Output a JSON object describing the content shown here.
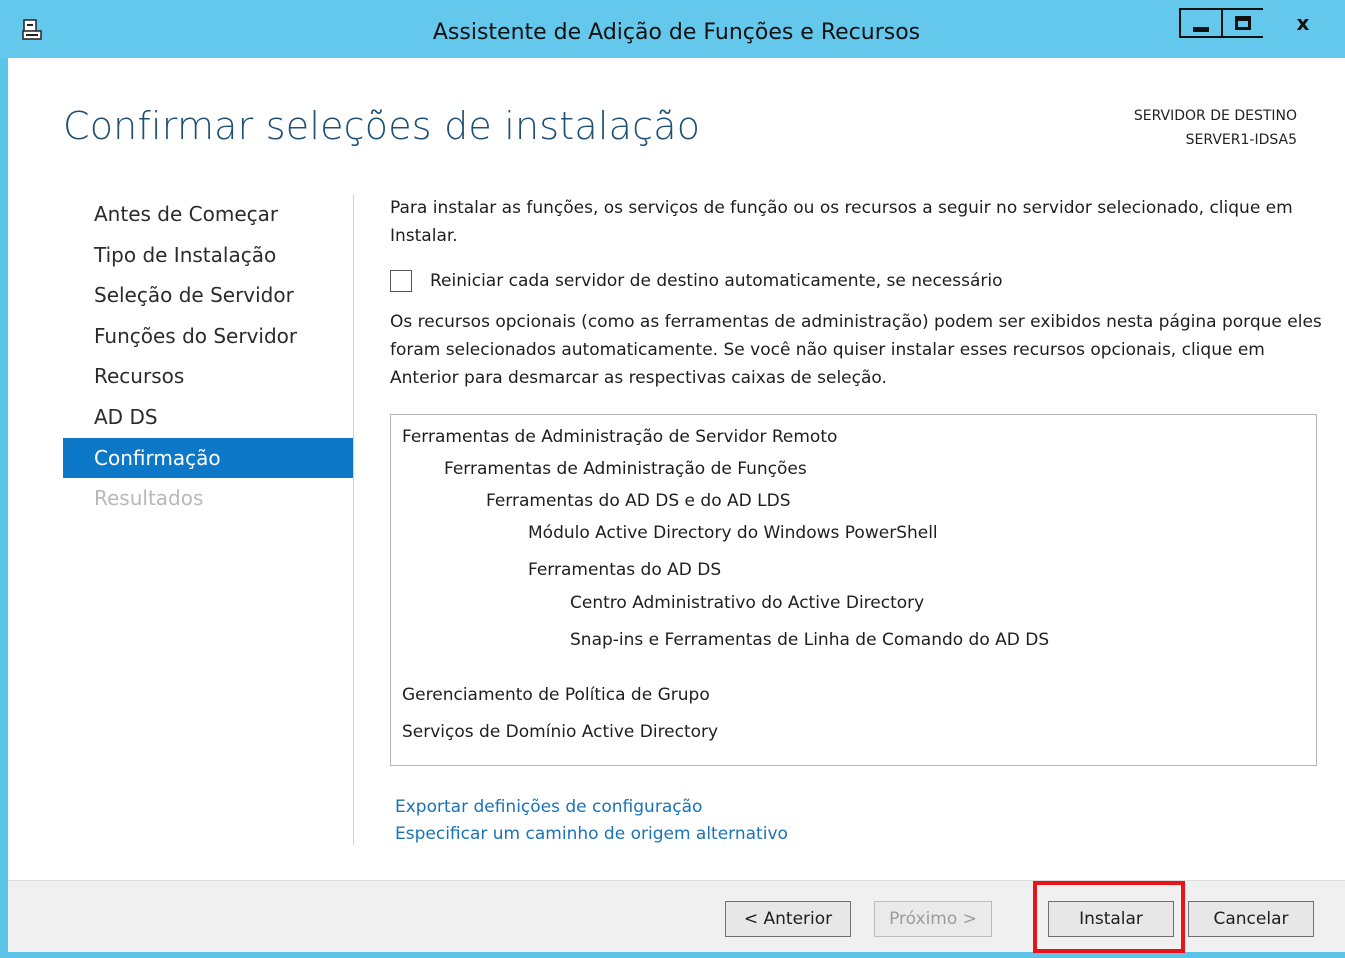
{
  "window": {
    "title": "Assistente de Adição de Funções e Recursos",
    "close_label": "x"
  },
  "header": {
    "page_title": "Confirmar seleções de instalação",
    "dest_label": "SERVIDOR DE DESTINO",
    "dest_server": "SERVER1-IDSA5"
  },
  "nav": {
    "items": [
      {
        "label": "Antes de Começar",
        "state": "normal"
      },
      {
        "label": "Tipo de Instalação",
        "state": "normal"
      },
      {
        "label": "Seleção de Servidor",
        "state": "normal"
      },
      {
        "label": "Funções do Servidor",
        "state": "normal"
      },
      {
        "label": "Recursos",
        "state": "normal"
      },
      {
        "label": "AD DS",
        "state": "normal"
      },
      {
        "label": "Confirmação",
        "state": "active"
      },
      {
        "label": "Resultados",
        "state": "disabled"
      }
    ]
  },
  "main": {
    "intro": "Para instalar as funções, os serviços de função ou os recursos a seguir no servidor selecionado, clique em Instalar.",
    "restart_checkbox": {
      "label": "Reiniciar cada servidor de destino automaticamente, se necessário",
      "checked": false
    },
    "optional_note": "Os recursos opcionais (como as ferramentas de administração) podem ser exibidos nesta página porque eles foram selecionados automaticamente. Se você não quiser instalar esses recursos opcionais, clique em Anterior para desmarcar as respectivas caixas de seleção.",
    "selections": [
      {
        "label": "Ferramentas de Administração de Servidor Remoto",
        "level": 0
      },
      {
        "label": "Ferramentas de Administração de Funções",
        "level": 1
      },
      {
        "label": "Ferramentas do AD DS e do AD LDS",
        "level": 2
      },
      {
        "label": "Módulo Active Directory do Windows PowerShell",
        "level": 3
      },
      {
        "label": "Ferramentas do AD DS",
        "level": 3
      },
      {
        "label": "Centro Administrativo do Active Directory",
        "level": 4
      },
      {
        "label": "Snap-ins e Ferramentas de Linha de Comando do AD DS",
        "level": 4
      },
      {
        "label": "Gerenciamento de Política de Grupo",
        "level": 0
      },
      {
        "label": "Serviços de Domínio Active Directory",
        "level": 0
      }
    ],
    "links": {
      "export": "Exportar definições de configuração",
      "alt_source": "Especificar um caminho de origem alternativo"
    }
  },
  "footer": {
    "prev_label": "< Anterior",
    "next_label": "Próximo >",
    "install_label": "Instalar",
    "cancel_label": "Cancelar"
  },
  "colors": {
    "titlebar": "#63c8ec",
    "accent": "#0d78c8",
    "link": "#1a73b8",
    "highlight": "#e8141c"
  }
}
